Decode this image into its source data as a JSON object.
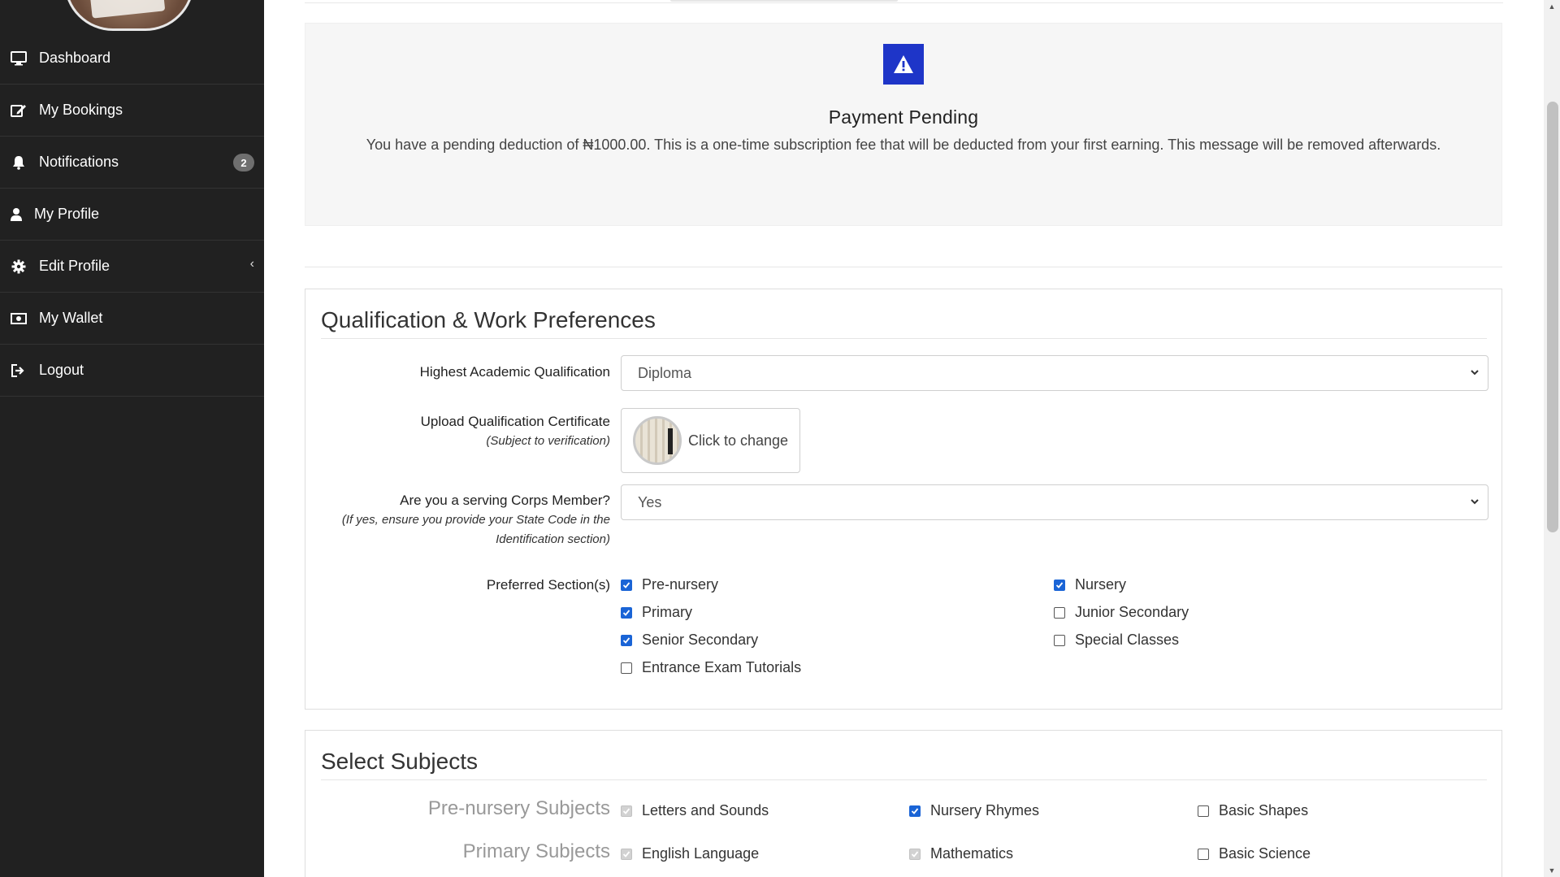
{
  "sidebar": {
    "items": [
      {
        "label": "Dashboard",
        "icon": "desktop-icon"
      },
      {
        "label": "My Bookings",
        "icon": "edit-icon"
      },
      {
        "label": "Notifications",
        "icon": "bell-icon",
        "badge": "2"
      },
      {
        "label": "My Profile",
        "icon": "user-icon"
      },
      {
        "label": "Edit Profile",
        "icon": "gear-icon",
        "chevron": "‹"
      },
      {
        "label": "My Wallet",
        "icon": "money-icon"
      },
      {
        "label": "Logout",
        "icon": "logout-icon"
      }
    ]
  },
  "pending": {
    "title": "Payment Pending",
    "message": "You have a pending deduction of ₦1000.00. This is a one-time subscription fee that will be deducted from your first earning. This message will be removed afterwards.",
    "accent": "#1e35c8"
  },
  "qualification": {
    "title": "Qualification & Work Preferences",
    "highest_label": "Highest Academic Qualification",
    "highest_value": "Diploma",
    "upload_label": "Upload Qualification Certificate",
    "upload_sub": "(Subject to verification)",
    "upload_button": "Click to change",
    "corps_label": "Are you a serving Corps Member?",
    "corps_sub": "(If yes, ensure you provide your State Code in the Identification section)",
    "corps_value": "Yes",
    "sections_label": "Preferred Section(s)",
    "sections": [
      {
        "label": "Pre-nursery",
        "checked": true
      },
      {
        "label": "Nursery",
        "checked": true
      },
      {
        "label": "Primary",
        "checked": true
      },
      {
        "label": "Junior Secondary",
        "checked": false
      },
      {
        "label": "Senior Secondary",
        "checked": true
      },
      {
        "label": "Special Classes",
        "checked": false
      },
      {
        "label": "Entrance Exam Tutorials",
        "checked": false
      }
    ]
  },
  "subjects": {
    "title": "Select Subjects",
    "groups": [
      {
        "label": "Pre-nursery Subjects",
        "items": [
          {
            "label": "Letters and Sounds",
            "state": "disabled"
          },
          {
            "label": "Nursery Rhymes",
            "state": "checked"
          },
          {
            "label": "Basic Shapes",
            "state": "unchecked"
          }
        ]
      },
      {
        "label": "Primary Subjects",
        "items": [
          {
            "label": "English Language",
            "state": "disabled"
          },
          {
            "label": "Mathematics",
            "state": "disabled"
          },
          {
            "label": "Basic Science",
            "state": "unchecked"
          }
        ]
      }
    ]
  },
  "colors": {
    "sidebar": "#212121",
    "checkbox": "#1a64d6"
  }
}
